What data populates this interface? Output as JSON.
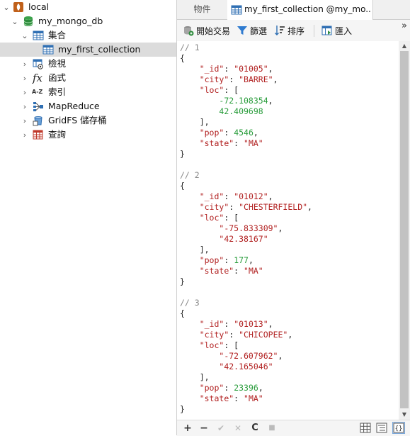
{
  "tree": {
    "connection": {
      "label": "local",
      "icon": "mongodb-leaf-icon"
    },
    "database": {
      "label": "my_mongo_db",
      "icon": "database-icon"
    },
    "collections_group": {
      "label": "集合",
      "icon": "table-grid-icon"
    },
    "collection": {
      "label": "my_first_collection",
      "icon": "table-grid-icon"
    },
    "nodes": [
      {
        "label": "檢視",
        "icon": "view-icon"
      },
      {
        "label": "函式",
        "icon": "function-icon"
      },
      {
        "label": "索引",
        "icon": "index-az-icon"
      },
      {
        "label": "MapReduce",
        "icon": "mapreduce-icon"
      },
      {
        "label": "GridFS 儲存桶",
        "icon": "gridfs-icon"
      },
      {
        "label": "查詢",
        "icon": "query-icon"
      }
    ]
  },
  "tabs": {
    "objects": "物件",
    "collection": "my_first_collection @my_mo..."
  },
  "toolbar": {
    "begin_transaction": "開始交易",
    "filter": "篩選",
    "sort": "排序",
    "import": "匯入",
    "overflow": "»"
  },
  "documents": [
    {
      "comment": "// 1",
      "_id": "\"01005\"",
      "city": "\"BARRE\"",
      "loc": [
        "-72.108354",
        "42.409698"
      ],
      "loc_is_string": false,
      "pop": "4546",
      "state": "\"MA\""
    },
    {
      "comment": "// 2",
      "_id": "\"01012\"",
      "city": "\"CHESTERFIELD\"",
      "loc": [
        "\"-75.833309\"",
        "\"42.38167\""
      ],
      "loc_is_string": true,
      "pop": "177",
      "state": "\"MA\""
    },
    {
      "comment": "// 3",
      "_id": "\"01013\"",
      "city": "\"CHICOPEE\"",
      "loc": [
        "\"-72.607962\"",
        "\"42.165046\""
      ],
      "loc_is_string": true,
      "pop": "23396",
      "state": "\"MA\""
    }
  ],
  "bottom": {
    "add": "+",
    "remove": "−",
    "apply": "✔",
    "discard": "✕",
    "refresh": "C",
    "stop": "■"
  },
  "colors": {
    "key": "#b22222",
    "number": "#2a9d3c",
    "comment": "#888888",
    "selected_row": "#dcdcdc"
  }
}
